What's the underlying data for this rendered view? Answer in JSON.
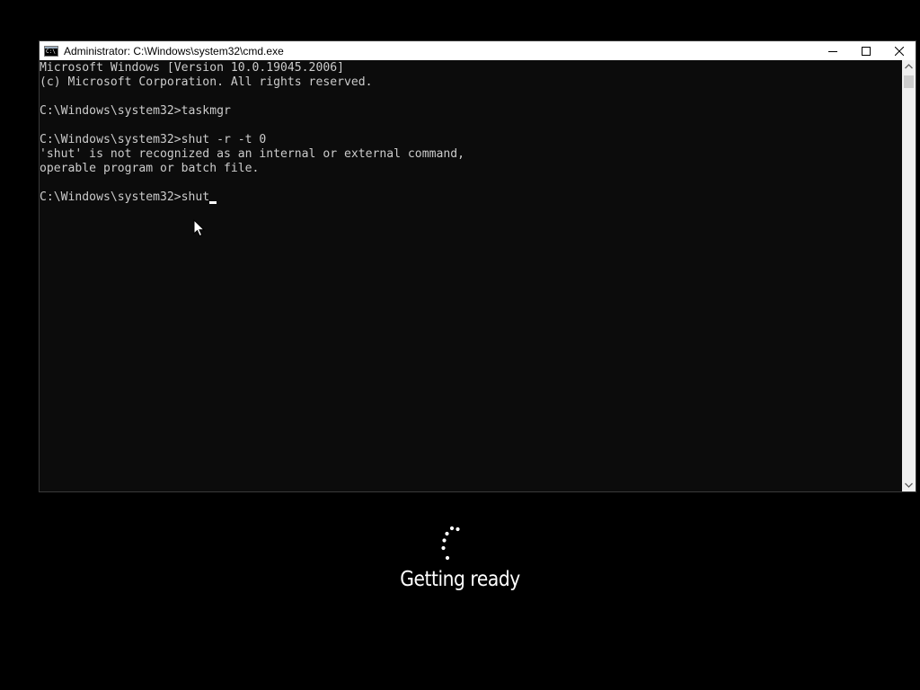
{
  "window": {
    "title": "Administrator: C:\\Windows\\system32\\cmd.exe",
    "icon": "cmd-app-icon",
    "icon_text": "C:\\",
    "controls": [
      "minimize-icon",
      "maximize-icon",
      "close-icon"
    ]
  },
  "console": {
    "text_color": "#cccccc",
    "background": "#0c0c0c",
    "lines": [
      "Microsoft Windows [Version 10.0.19045.2006]",
      "(c) Microsoft Corporation. All rights reserved.",
      "",
      "C:\\Windows\\system32>taskmgr",
      "",
      "C:\\Windows\\system32>shut -r -t 0",
      "'shut' is not recognized as an internal or external command,",
      "operable program or batch file.",
      "",
      "C:\\Windows\\system32>shut"
    ]
  },
  "overlay": {
    "status": "Getting ready",
    "spinner_icon": "loading-dots-icon",
    "text_color": "#ffffff"
  },
  "pointer": {
    "icon": "mouse-pointer-icon"
  }
}
